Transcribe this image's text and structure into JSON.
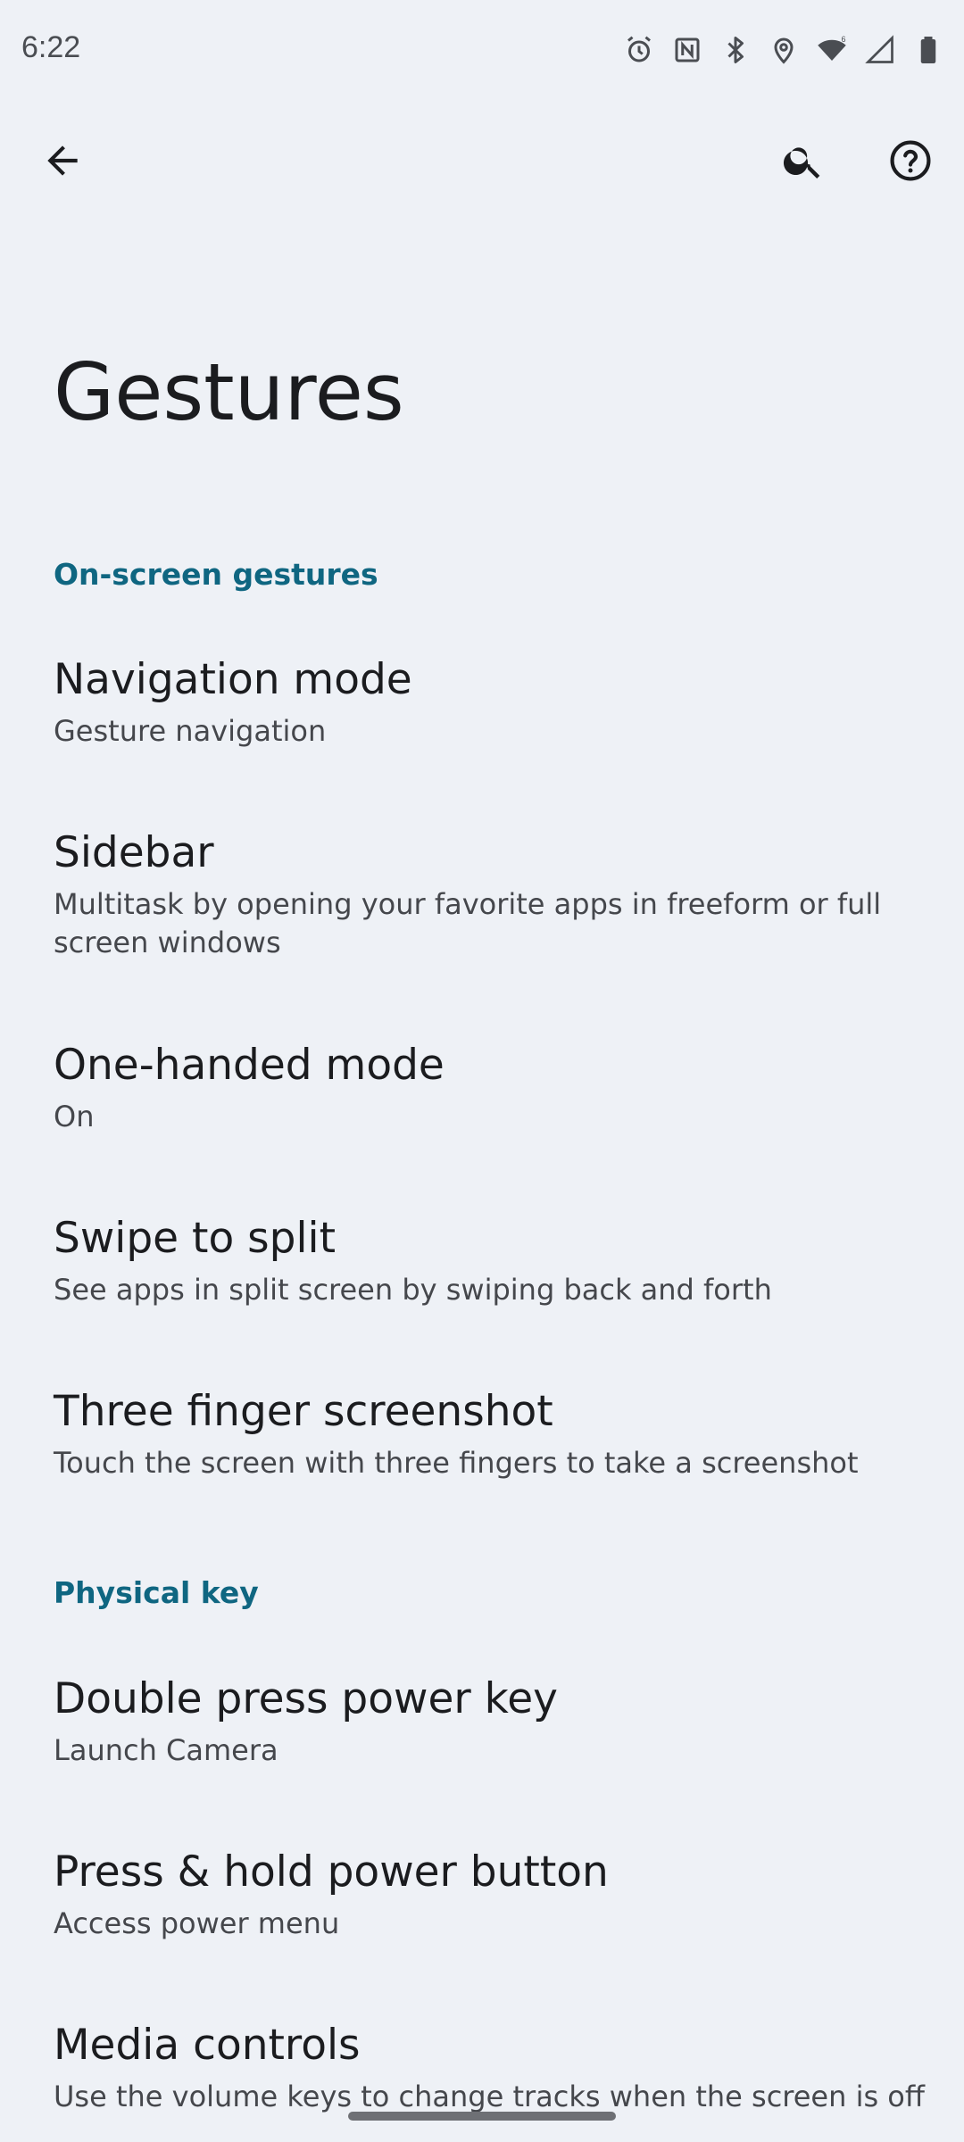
{
  "status_bar": {
    "time": "6:22",
    "icons": [
      "alarm-icon",
      "nfc-icon",
      "bluetooth-icon",
      "location-icon",
      "wifi-icon",
      "signal-icon",
      "battery-icon"
    ]
  },
  "app_bar": {
    "back_icon": "arrow-back-icon",
    "search_icon": "search-icon",
    "help_icon": "help-icon"
  },
  "page": {
    "title": "Gestures"
  },
  "sections": [
    {
      "header": "On-screen gestures",
      "items": [
        {
          "title": "Navigation mode",
          "summary": "Gesture navigation"
        },
        {
          "title": "Sidebar",
          "summary": "Multitask by opening your favorite apps in freeform or full screen windows"
        },
        {
          "title": "One-handed mode",
          "summary": "On"
        },
        {
          "title": "Swipe to split",
          "summary": "See apps in split screen by swiping back and forth"
        },
        {
          "title": "Three finger screenshot",
          "summary": "Touch the screen with three fingers to take a screenshot"
        }
      ]
    },
    {
      "header": "Physical key",
      "items": [
        {
          "title": "Double press power key",
          "summary": "Launch Camera"
        },
        {
          "title": "Press & hold power button",
          "summary": "Access power menu"
        },
        {
          "title": "Media controls",
          "summary": "Use the volume keys to change tracks when the screen is off"
        }
      ]
    }
  ],
  "colors": {
    "background": "#eef1f6",
    "accent": "#0f6681",
    "primary_text": "#1b1c1f",
    "secondary_text": "#45474c"
  }
}
